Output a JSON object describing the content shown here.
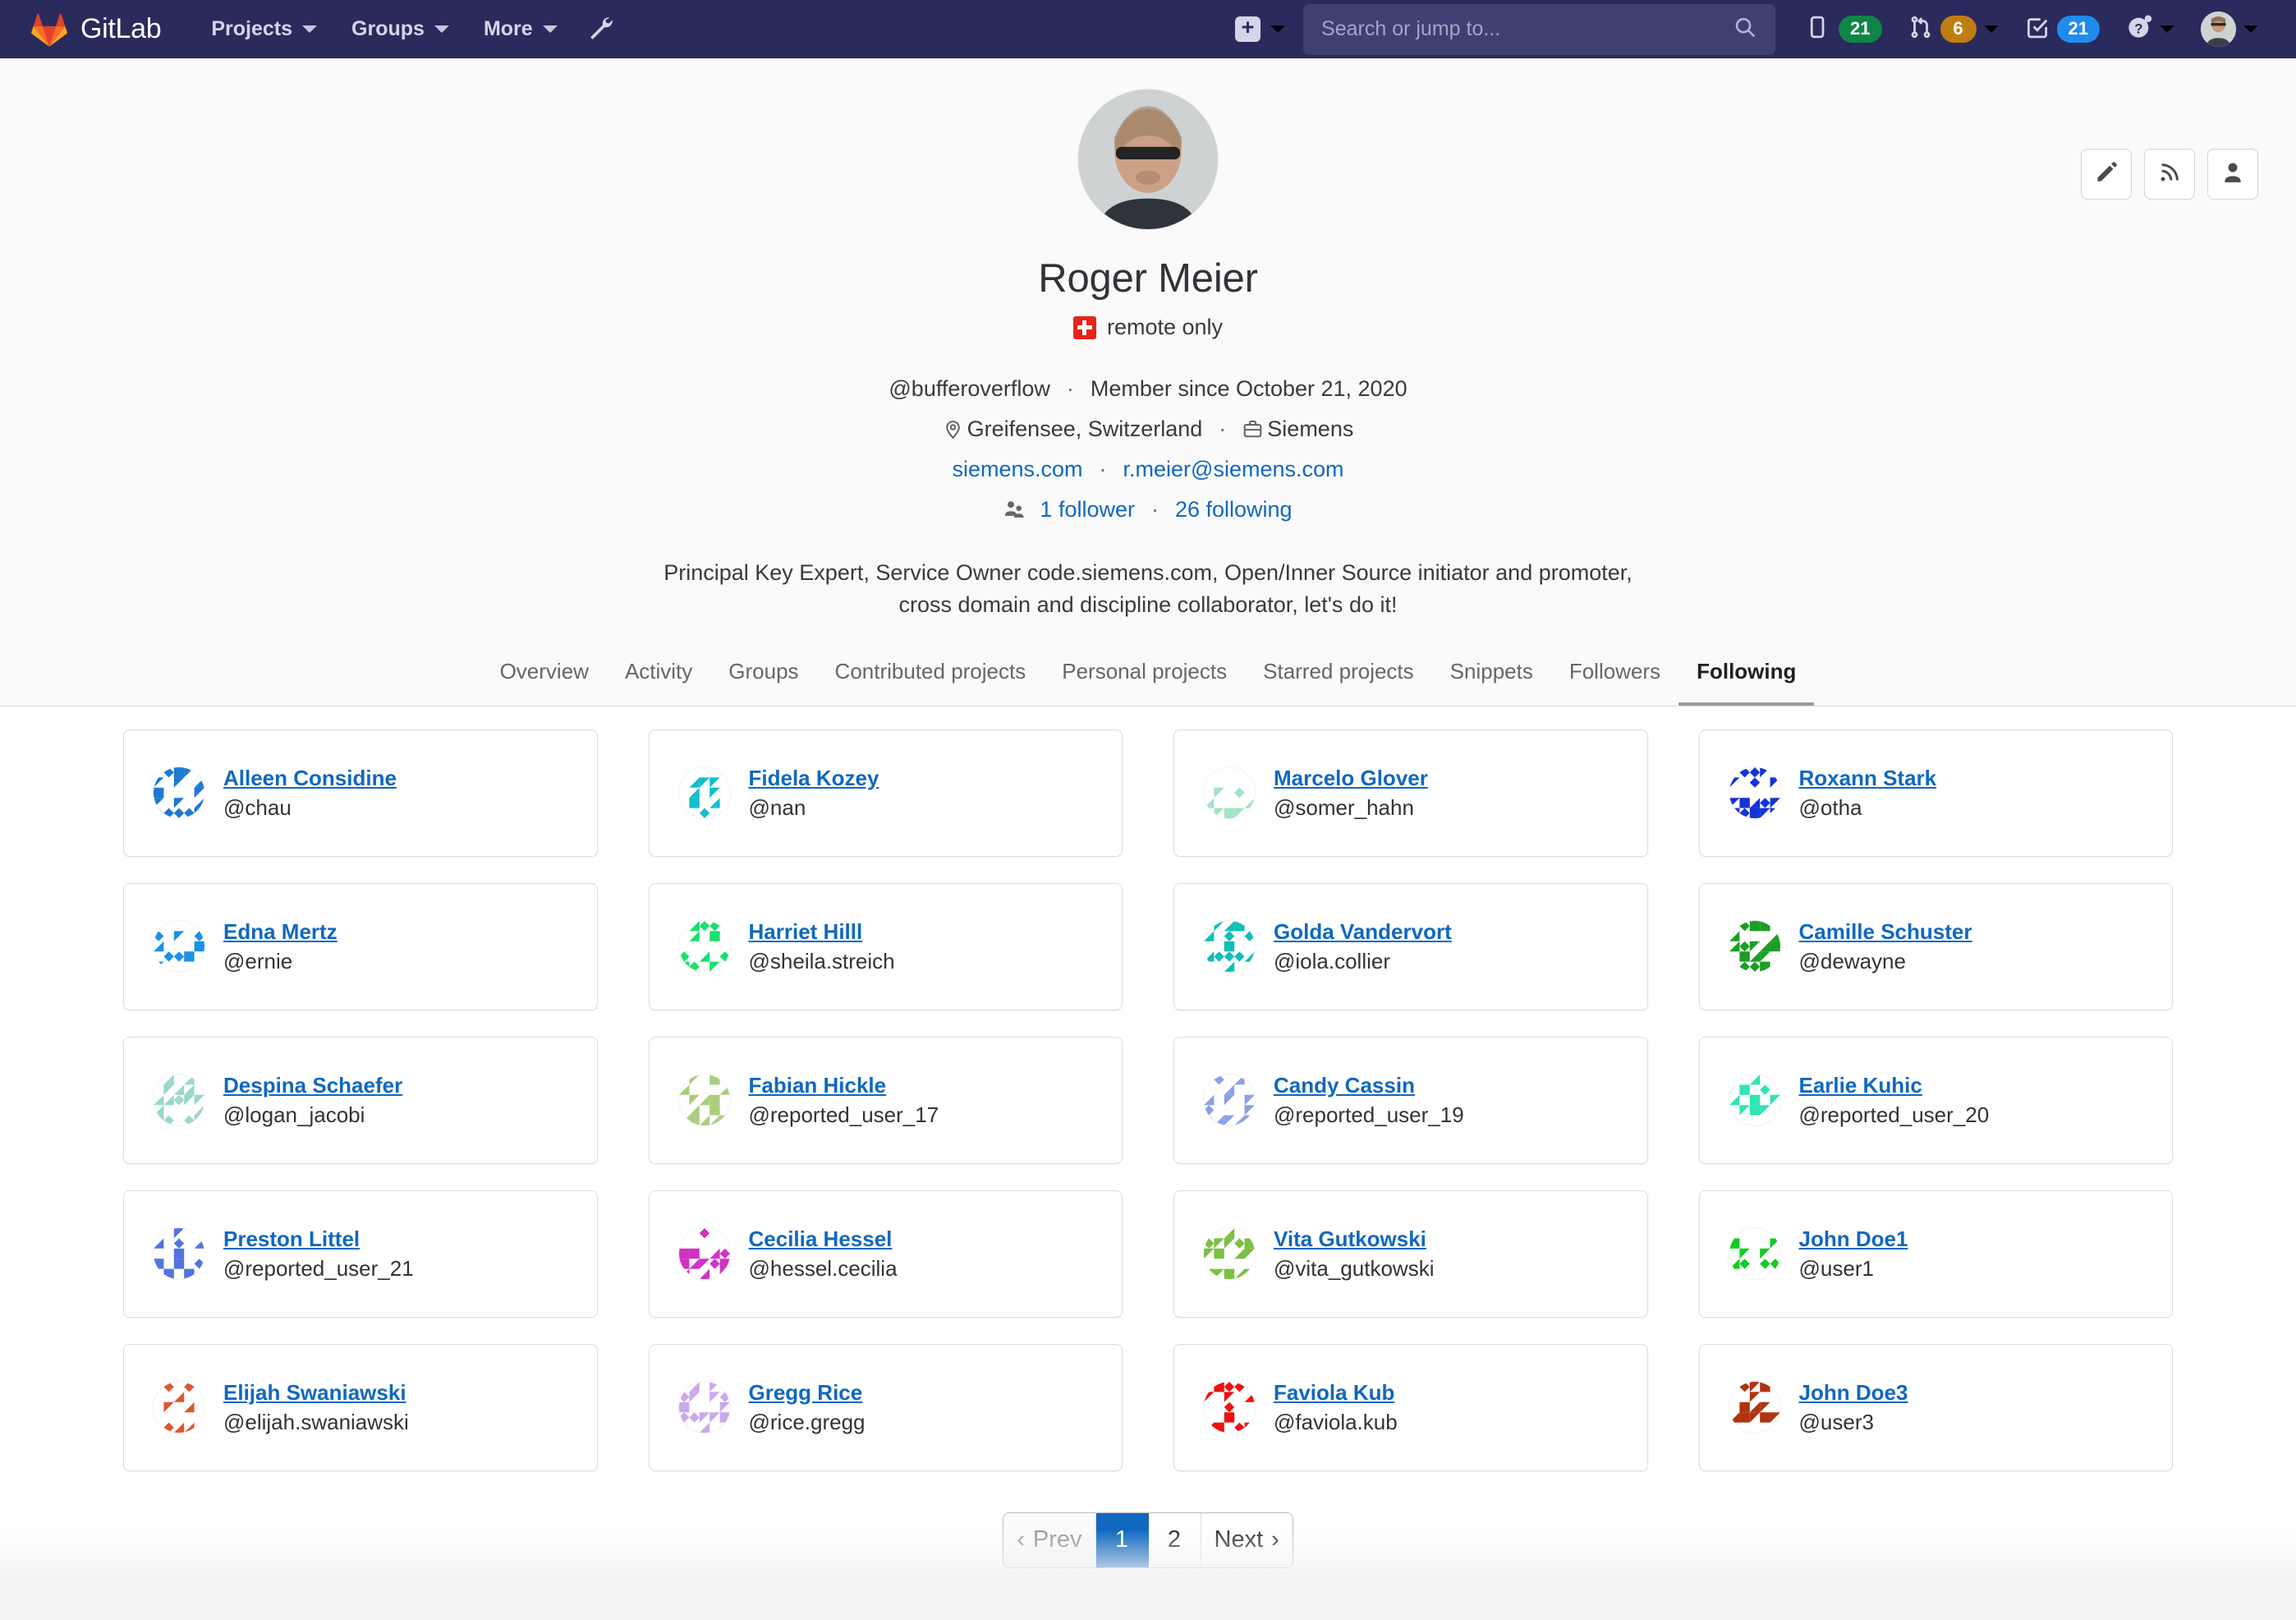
{
  "navbar": {
    "brand": "GitLab",
    "brand_logo_icon": "gitlab-tanuki-logo",
    "links": [
      {
        "label": "Projects",
        "icon": "chevron-down-icon"
      },
      {
        "label": "Groups",
        "icon": "chevron-down-icon"
      },
      {
        "label": "More",
        "icon": "chevron-down-icon"
      }
    ],
    "admin_icon": "wrench-icon",
    "new_dropdown": {
      "icon": "plus-square-icon",
      "caret": "chevron-down-icon"
    },
    "search": {
      "placeholder": "Search or jump to...",
      "value": "",
      "icon": "search-icon"
    },
    "counters": [
      {
        "name": "issues",
        "icon": "issues-icon",
        "count": "21",
        "color": "#108548"
      },
      {
        "name": "merge-requests",
        "icon": "merge-request-icon",
        "count": "6",
        "color": "#c17d10",
        "caret": "chevron-down-icon"
      },
      {
        "name": "todos",
        "icon": "todo-checkbox-icon",
        "count": "21",
        "color": "#1f8ceb"
      }
    ],
    "help": {
      "icon": "question-circle-icon",
      "caret": "chevron-down-icon"
    },
    "user_menu": {
      "icon": "user-avatar",
      "caret": "chevron-down-icon"
    }
  },
  "header_actions": [
    {
      "name": "edit-profile",
      "icon": "pencil-icon"
    },
    {
      "name": "subscribe-rss",
      "icon": "rss-icon"
    },
    {
      "name": "report-abuse",
      "icon": "user-icon"
    }
  ],
  "profile": {
    "avatar_icon": "profile-photo",
    "name": "Roger Meier",
    "status_emoji": "swiss-flag",
    "status_text": "remote only",
    "username": "@bufferoverflow",
    "member_since": "Member since October 21, 2020",
    "location_icon": "location-pin-icon",
    "location": "Greifensee, Switzerland",
    "work_icon": "briefcase-icon",
    "organization": "Siemens",
    "website": "siemens.com",
    "email": "r.meier@siemens.com",
    "followers_icon": "users-icon",
    "followers": "1 follower",
    "following": "26 following",
    "bio": "Principal Key Expert, Service Owner code.siemens.com, Open/Inner Source initiator and promoter, cross domain and discipline collaborator, let's do it!",
    "separator": "·"
  },
  "tabs": [
    {
      "label": "Overview",
      "active": false
    },
    {
      "label": "Activity",
      "active": false
    },
    {
      "label": "Groups",
      "active": false
    },
    {
      "label": "Contributed projects",
      "active": false
    },
    {
      "label": "Personal projects",
      "active": false
    },
    {
      "label": "Starred projects",
      "active": false
    },
    {
      "label": "Snippets",
      "active": false
    },
    {
      "label": "Followers",
      "active": false
    },
    {
      "label": "Following",
      "active": true
    }
  ],
  "following_users": [
    {
      "name": "Alleen Considine",
      "handle": "@chau",
      "color": "#1f78d1",
      "seed": 3
    },
    {
      "name": "Fidela Kozey",
      "handle": "@nan",
      "color": "#11bfcf",
      "seed": 11
    },
    {
      "name": "Marcelo Glover",
      "handle": "@somer_hahn",
      "color": "#a4e3c4",
      "seed": 21
    },
    {
      "name": "Roxann Stark",
      "handle": "@otha",
      "color": "#1434d6",
      "seed": 7
    },
    {
      "name": "Edna Mertz",
      "handle": "@ernie",
      "color": "#1b92e8",
      "seed": 31
    },
    {
      "name": "Harriet Hilll",
      "handle": "@sheila.streich",
      "color": "#17e06c",
      "seed": 41
    },
    {
      "name": "Golda Vandervort",
      "handle": "@iola.collier",
      "color": "#0dbfb8",
      "seed": 51
    },
    {
      "name": "Camille Schuster",
      "handle": "@dewayne",
      "color": "#1b9e23",
      "seed": 61
    },
    {
      "name": "Despina Schaefer",
      "handle": "@logan_jacobi",
      "color": "#9ad8cb",
      "seed": 71
    },
    {
      "name": "Fabian Hickle",
      "handle": "@reported_user_17",
      "color": "#a8ce7e",
      "seed": 81
    },
    {
      "name": "Candy Cassin",
      "handle": "@reported_user_19",
      "color": "#8aa1e8",
      "seed": 91
    },
    {
      "name": "Earlie Kuhic",
      "handle": "@reported_user_20",
      "color": "#2fe5b4",
      "seed": 101
    },
    {
      "name": "Preston Littel",
      "handle": "@reported_user_21",
      "color": "#5573df",
      "seed": 111
    },
    {
      "name": "Cecilia Hessel",
      "handle": "@hessel.cecilia",
      "color": "#d131c2",
      "seed": 121
    },
    {
      "name": "Vita Gutkowski",
      "handle": "@vita_gutkowski",
      "color": "#7cc043",
      "seed": 131
    },
    {
      "name": "John Doe1",
      "handle": "@user1",
      "color": "#11cc22",
      "seed": 141
    },
    {
      "name": "Elijah Swaniawski",
      "handle": "@elijah.swaniawski",
      "color": "#e05533",
      "seed": 151
    },
    {
      "name": "Gregg Rice",
      "handle": "@rice.gregg",
      "color": "#caa8ee",
      "seed": 161
    },
    {
      "name": "Faviola Kub",
      "handle": "@faviola.kub",
      "color": "#ee1111",
      "seed": 171
    },
    {
      "name": "John Doe3",
      "handle": "@user3",
      "color": "#b03311",
      "seed": 181
    }
  ],
  "pagination": {
    "prev": {
      "label": "Prev",
      "icon": "chevron-left-icon",
      "disabled": true
    },
    "pages": [
      {
        "label": "1",
        "active": true
      },
      {
        "label": "2",
        "active": false
      }
    ],
    "next": {
      "label": "Next",
      "icon": "chevron-right-icon",
      "disabled": false
    },
    "accent_color": "#1068bf"
  }
}
